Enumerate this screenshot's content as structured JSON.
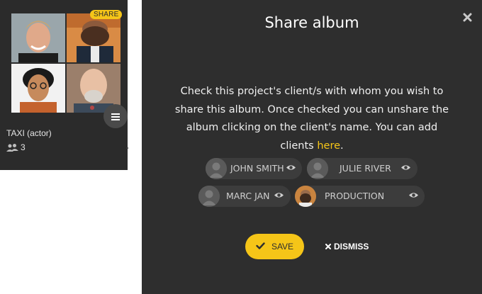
{
  "album_card": {
    "badge": "SHARE",
    "title": "TAXI (actor)",
    "count": "3",
    "menu_icon": "hamburger-icon",
    "people_icon": "users-icon"
  },
  "modal": {
    "title": "Share album",
    "close_icon": "close-icon",
    "description": "Check this project's client/s with whom you wish to share this album. Once checked you can unshare the album clicking on the client's name. You can add clients",
    "link_text": "here",
    "link_suffix": ".",
    "clients": [
      {
        "name": "JOHN SMITH",
        "icon": "eye-icon"
      },
      {
        "name": "JULIE RIVER",
        "icon": "eye-icon"
      },
      {
        "name": "MARC JAN",
        "icon": "eye-icon"
      },
      {
        "name": "PRODUCTION",
        "icon": "eye-icon"
      }
    ],
    "save_label": "SAVE",
    "dismiss_label": "DISMISS",
    "colors": {
      "accent": "#f5c518",
      "background": "#2e2e2e",
      "chip": "#3c3c3c"
    }
  }
}
